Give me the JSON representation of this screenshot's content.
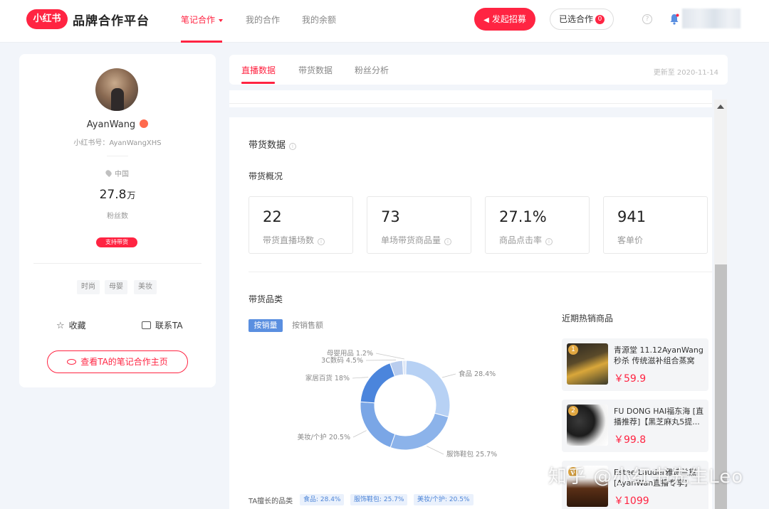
{
  "header": {
    "logo_badge": "小红书",
    "logo_text": "品牌合作平台",
    "nav": [
      {
        "label": "笔记合作",
        "active": true
      },
      {
        "label": "我的合作",
        "active": false
      },
      {
        "label": "我的余额",
        "active": false
      }
    ],
    "primary_button": "发起招募",
    "selected_button": "已选合作",
    "selected_count": "0",
    "help_glyph": "?"
  },
  "profile": {
    "name": "AyanWang",
    "id_line": "小红书号：AyanWangXHS",
    "location": "中国",
    "fans_value": "27.8",
    "fans_unit": "万",
    "fans_label": "粉丝数",
    "sell_badge": "支持带货",
    "tags": [
      "时尚",
      "母婴",
      "美妆"
    ],
    "favorite_label": "收藏",
    "contact_label": "联系TA",
    "home_button": "查看TA的笔记合作主页"
  },
  "tabs": {
    "items": [
      {
        "label": "直播数据",
        "active": true
      },
      {
        "label": "带货数据",
        "active": false
      },
      {
        "label": "粉丝分析",
        "active": false
      }
    ],
    "updated": "更新至 2020-11-14"
  },
  "main": {
    "section_title": "带货数据",
    "overview_title": "带货概况",
    "stats": [
      {
        "value": "22",
        "label": "带货直播场数",
        "info": true
      },
      {
        "value": "73",
        "label": "单场带货商品量",
        "info": true
      },
      {
        "value": "27.1%",
        "label": "商品点击率",
        "info": true
      },
      {
        "value": "941",
        "label": "客单价",
        "info": false
      }
    ],
    "category_title": "带货品类",
    "toggle_active": "按销量",
    "toggle_other": "按销售额",
    "best_label": "TA擅长的品类",
    "best_tags": [
      "食品: 28.4%",
      "服饰鞋包: 25.7%",
      "美妆/个护: 20.5%"
    ],
    "hot_title": "近期热销商品",
    "products": [
      {
        "rank": "1",
        "name": "青源堂 11.12AyanWang秒杀 传统滋补组合蒸窝秋...",
        "price": "￥59.9"
      },
      {
        "rank": "2",
        "name": "FU DONG HAI福东海 [直播推荐]【黑芝麻丸5提...",
        "price": "￥99.8"
      },
      {
        "rank": "3",
        "name": "Estee Lauder雅诗兰黛 [AyanWan直播专享]",
        "price": "￥1099"
      }
    ]
  },
  "chart_data": {
    "type": "pie",
    "title": "",
    "categories": [
      "食品",
      "服饰鞋包",
      "美妆/个护",
      "家居百货",
      "3C数码",
      "母婴用品"
    ],
    "values": [
      28.4,
      25.7,
      20.5,
      18,
      4.5,
      1.2
    ],
    "labels": [
      "食品 28.4%",
      "服饰鞋包 25.7%",
      "美妆/个护 20.5%",
      "家居百货 18%",
      "3C数码 4.5%",
      "母婴用品 1.2%"
    ],
    "colors": [
      "#b7d1f4",
      "#8cb3ea",
      "#7aa6e6",
      "#4b85dc",
      "#b9cdee",
      "#dfe8f7"
    ],
    "legend": "none"
  },
  "watermark": "知乎 @小红书先生Leo",
  "colors": {
    "brand": "#ff2442",
    "accent_blue": "#5a8fe0"
  }
}
